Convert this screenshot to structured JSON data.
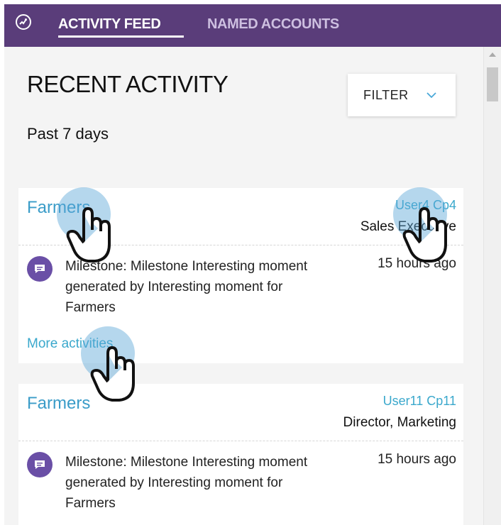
{
  "nav": {
    "logo_icon": "brand-logo-icon",
    "tabs": [
      {
        "label": "ACTIVITY FEED",
        "active": true
      },
      {
        "label": "NAMED ACCOUNTS",
        "active": false
      }
    ]
  },
  "header": {
    "title": "RECENT ACTIVITY",
    "subtitle": "Past 7 days",
    "filter_label": "FILTER",
    "filter_icon": "chevron-down-icon"
  },
  "cards": [
    {
      "account": "Farmers",
      "user_name": "User4 Cp4",
      "user_role": "Sales Executive",
      "activity_icon": "chat-bubble-icon",
      "activity_text": "Milestone: Milestone Interesting moment generated by Interesting moment for Farmers",
      "activity_time": "15 hours ago",
      "more_label": "More activities"
    },
    {
      "account": "Farmers",
      "user_name": "User11 Cp11",
      "user_role": "Director, Marketing",
      "activity_icon": "chat-bubble-icon",
      "activity_text": "Milestone: Milestone Interesting moment generated by Interesting moment for Farmers",
      "activity_time": "15 hours ago"
    }
  ],
  "colors": {
    "topbar": "#5a3d7a",
    "link": "#3a9cc8",
    "icon_bg": "#6a4fa6",
    "panel_bg": "#f4f4f4"
  }
}
